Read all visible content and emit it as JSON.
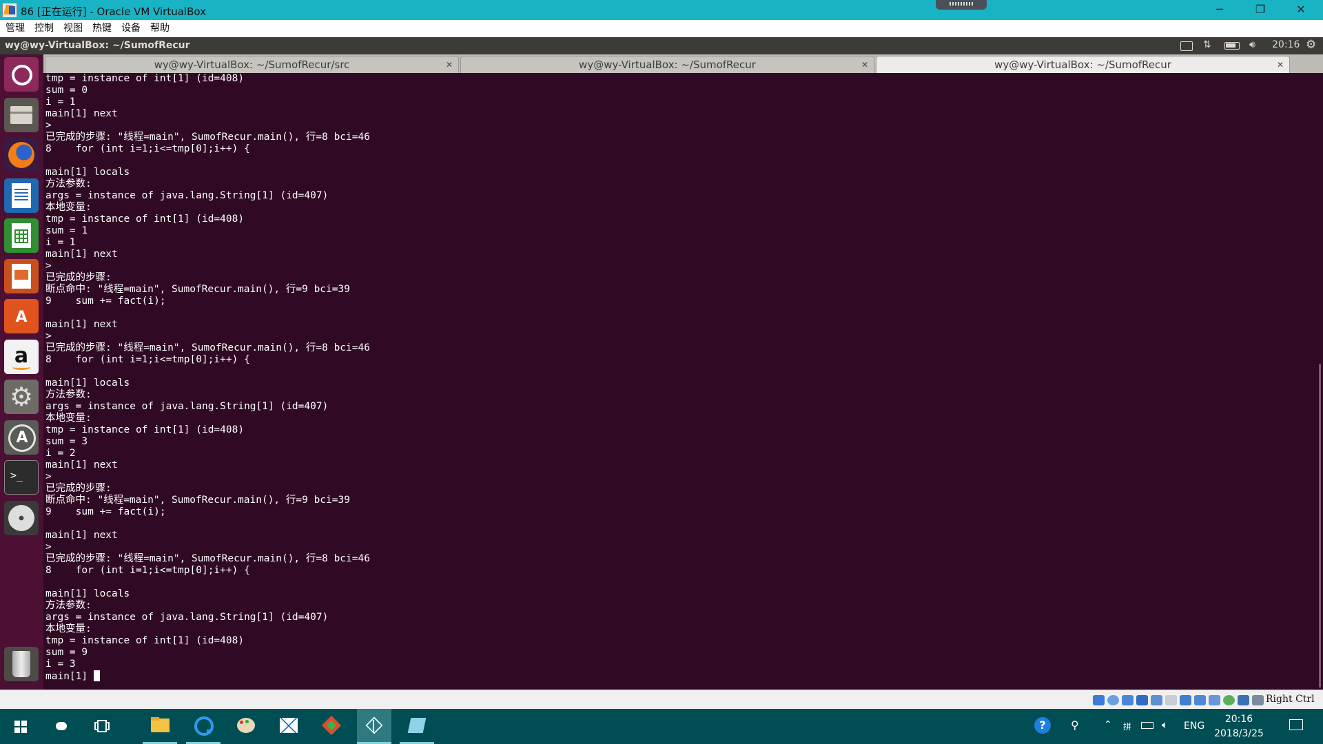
{
  "window": {
    "title": "86 [正在运行] - Oracle VM VirtualBox",
    "controls": [
      "─",
      "❐",
      "✕"
    ]
  },
  "menu": [
    "管理",
    "控制",
    "视图",
    "热键",
    "设备",
    "帮助"
  ],
  "ubuntu_panel": {
    "title": "wy@wy-VirtualBox: ~/SumofRecur",
    "time": "20:16"
  },
  "launcher_icons": [
    "ubuntu-dash-icon",
    "files-icon",
    "firefox-icon",
    "writer-icon",
    "calc-icon",
    "impress-icon",
    "software-center-icon",
    "amazon-icon",
    "system-settings-icon",
    "software-updater-icon",
    "terminal-icon",
    "dvd-icon",
    "trash-icon"
  ],
  "tabs": [
    {
      "label": "wy@wy-VirtualBox: ~/SumofRecur/src",
      "active": false
    },
    {
      "label": "wy@wy-VirtualBox: ~/SumofRecur",
      "active": false
    },
    {
      "label": "wy@wy-VirtualBox: ~/SumofRecur",
      "active": true
    }
  ],
  "terminal_lines": [
    "tmp = instance of int[1] (id=408)",
    "sum = 0",
    "i = 1",
    "main[1] next",
    ">",
    "已完成的步骤: \"线程=main\", SumofRecur.main(), 行=8 bci=46",
    "8    for (int i=1;i<=tmp[0];i++) {",
    "",
    "main[1] locals",
    "方法参数:",
    "args = instance of java.lang.String[1] (id=407)",
    "本地变量:",
    "tmp = instance of int[1] (id=408)",
    "sum = 1",
    "i = 1",
    "main[1] next",
    ">",
    "已完成的步骤:",
    "断点命中: \"线程=main\", SumofRecur.main(), 行=9 bci=39",
    "9    sum += fact(i);",
    "",
    "main[1] next",
    ">",
    "已完成的步骤: \"线程=main\", SumofRecur.main(), 行=8 bci=46",
    "8    for (int i=1;i<=tmp[0];i++) {",
    "",
    "main[1] locals",
    "方法参数:",
    "args = instance of java.lang.String[1] (id=407)",
    "本地变量:",
    "tmp = instance of int[1] (id=408)",
    "sum = 3",
    "i = 2",
    "main[1] next",
    ">",
    "已完成的步骤:",
    "断点命中: \"线程=main\", SumofRecur.main(), 行=9 bci=39",
    "9    sum += fact(i);",
    "",
    "main[1] next",
    ">",
    "已完成的步骤: \"线程=main\", SumofRecur.main(), 行=8 bci=46",
    "8    for (int i=1;i<=tmp[0];i++) {",
    "",
    "main[1] locals",
    "方法参数:",
    "args = instance of java.lang.String[1] (id=407)",
    "本地变量:",
    "tmp = instance of int[1] (id=408)",
    "sum = 9",
    "i = 3"
  ],
  "prompt": "main[1] ",
  "status_bar": {
    "host_key": "Right Ctrl",
    "icons": [
      "hard-disk-icon",
      "optical-drive-icon",
      "audio-icon",
      "network-icon",
      "usb-icon",
      "shared-folders-icon",
      "display-icon",
      "video-capture-icon",
      "capture-icon",
      "cpu-icon",
      "mouse-integration-icon",
      "keyboard-icon"
    ]
  },
  "taskbar": {
    "apps": [
      "file-explorer-icon",
      "browser-icon",
      "paint-icon",
      "mail-icon",
      "git-icon",
      "virtualbox-icon",
      "notepad-icon"
    ],
    "language": "ENG",
    "time": "20:16",
    "date": "2018/3/25"
  },
  "colors": {
    "vb_titlebar": "#18b3c4",
    "terminal_bg": "#300a24",
    "launcher_bg": "#4b1034",
    "taskbar": "#004e54"
  }
}
